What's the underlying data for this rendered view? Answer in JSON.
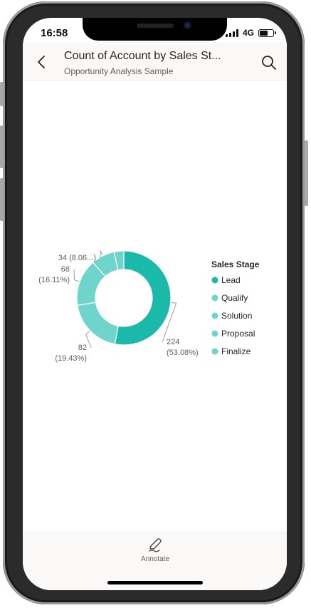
{
  "status_bar": {
    "time": "16:58",
    "network": "4G"
  },
  "header": {
    "title": "Count of Account by Sales St...",
    "subtitle": "Opportunity Analysis Sample"
  },
  "footer": {
    "annotate_label": "Annotate"
  },
  "chart_data": {
    "type": "pie",
    "donut": true,
    "legend_title": "Sales Stage",
    "legend_position": "right",
    "categories": [
      "Lead",
      "Qualify",
      "Solution",
      "Proposal",
      "Finalize"
    ],
    "values": [
      224,
      82,
      68,
      34,
      14
    ],
    "colors": [
      "#1ab9a9",
      "#6ed4cc",
      "#6ed4cc",
      "#6ed4cc",
      "#6ed4cc"
    ],
    "data_labels": [
      {
        "category": "Lead",
        "value": "224",
        "percent": "(53.08%)"
      },
      {
        "category": "Qualify",
        "value": "82",
        "percent": "(19.43%)"
      },
      {
        "category": "Solution",
        "value": "68",
        "percent": "(16.11%)"
      },
      {
        "category": "Proposal",
        "value": "34 (8.06...)",
        "percent": ""
      }
    ]
  }
}
